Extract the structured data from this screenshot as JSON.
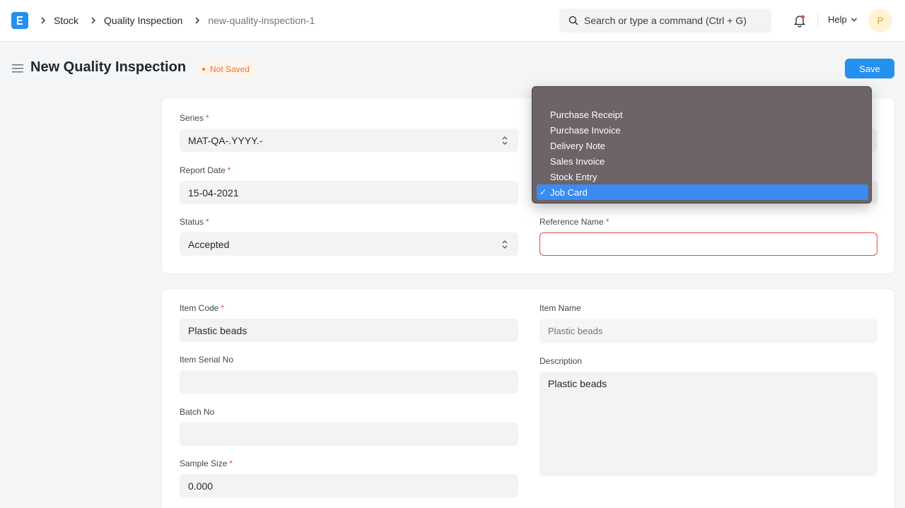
{
  "navbar": {
    "breadcrumbs": [
      "Stock",
      "Quality Inspection",
      "new-quality-inspection-1"
    ],
    "search_placeholder": "Search or type a command (Ctrl + G)",
    "help_label": "Help",
    "avatar_initial": "P"
  },
  "page": {
    "title": "New Quality Inspection",
    "status_indicator": "Not Saved",
    "save_label": "Save"
  },
  "form": {
    "series": {
      "label": "Series",
      "value": "MAT-QA-.YYYY.-"
    },
    "report_date": {
      "label": "Report Date",
      "value": "15-04-2021"
    },
    "status": {
      "label": "Status",
      "value": "Accepted"
    },
    "reference_name": {
      "label": "Reference Name",
      "value": ""
    },
    "item_code": {
      "label": "Item Code",
      "value": "Plastic beads"
    },
    "item_name": {
      "label": "Item Name",
      "value": "Plastic beads"
    },
    "item_serial_no": {
      "label": "Item Serial No",
      "value": ""
    },
    "description": {
      "label": "Description",
      "value": "Plastic beads"
    },
    "batch_no": {
      "label": "Batch No",
      "value": ""
    },
    "sample_size": {
      "label": "Sample Size",
      "value": "0.000"
    }
  },
  "dropdown": {
    "options": [
      {
        "label": "Purchase Receipt",
        "selected": false
      },
      {
        "label": "Purchase Invoice",
        "selected": false
      },
      {
        "label": "Delivery Note",
        "selected": false
      },
      {
        "label": "Sales Invoice",
        "selected": false
      },
      {
        "label": "Stock Entry",
        "selected": false
      },
      {
        "label": "Job Card",
        "selected": true
      }
    ],
    "check_glyph": "✓"
  },
  "colors": {
    "primary": "#2490ef",
    "required": "#e24c4c",
    "not_saved": "#f0722d",
    "dropdown_bg": "#6c6467",
    "dropdown_selected": "#3b8cf0"
  }
}
